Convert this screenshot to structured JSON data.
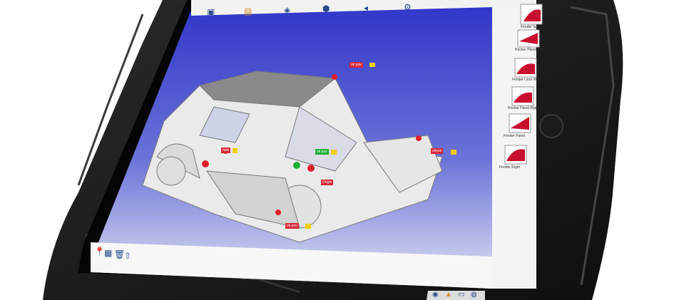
{
  "screen": {
    "gradient_top": "#2f35c8",
    "gradient_bottom": "#d8dcef",
    "panel_bg": "#f4f4f4"
  },
  "toolbar": {
    "icons": [
      "save-icon",
      "folder-icon",
      "layers-icon",
      "parts-icon",
      "measure-icon",
      "settings-icon"
    ]
  },
  "side_panel": {
    "items": [
      {
        "label": "Fender fa..",
        "icon": "part-thumbnail-icon"
      },
      {
        "label": "Rocker Panel Left",
        "icon": "part-thumbnail-icon"
      },
      {
        "label": "Fender Liner Right",
        "icon": "part-thumbnail-icon"
      },
      {
        "label": "Rocker Panel Right",
        "icon": "part-thumbnail-icon"
      },
      {
        "label": "Fender Panel",
        "icon": "part-thumbnail-icon"
      },
      {
        "label": "Fender Right",
        "icon": "part-thumbnail-icon"
      }
    ]
  },
  "markers": [
    {
      "label": "ok pos"
    },
    {
      "label": "check"
    },
    {
      "label": "ok pos"
    },
    {
      "label": "hole"
    },
    {
      "label": "Origin"
    },
    {
      "label": "ok pos"
    }
  ],
  "bottom_tools": [
    "pin-icon",
    "grid-icon",
    "trash-icon",
    "arrow-icon"
  ],
  "status_icons": [
    "camera-icon",
    "lock-icon",
    "display-icon",
    "globe-icon"
  ],
  "colors": {
    "case": "#1a1a1a",
    "marker_red": "#e0202a",
    "marker_yellow": "#f0d000",
    "marker_green": "#19b035",
    "tag_red": "#d8283a"
  }
}
